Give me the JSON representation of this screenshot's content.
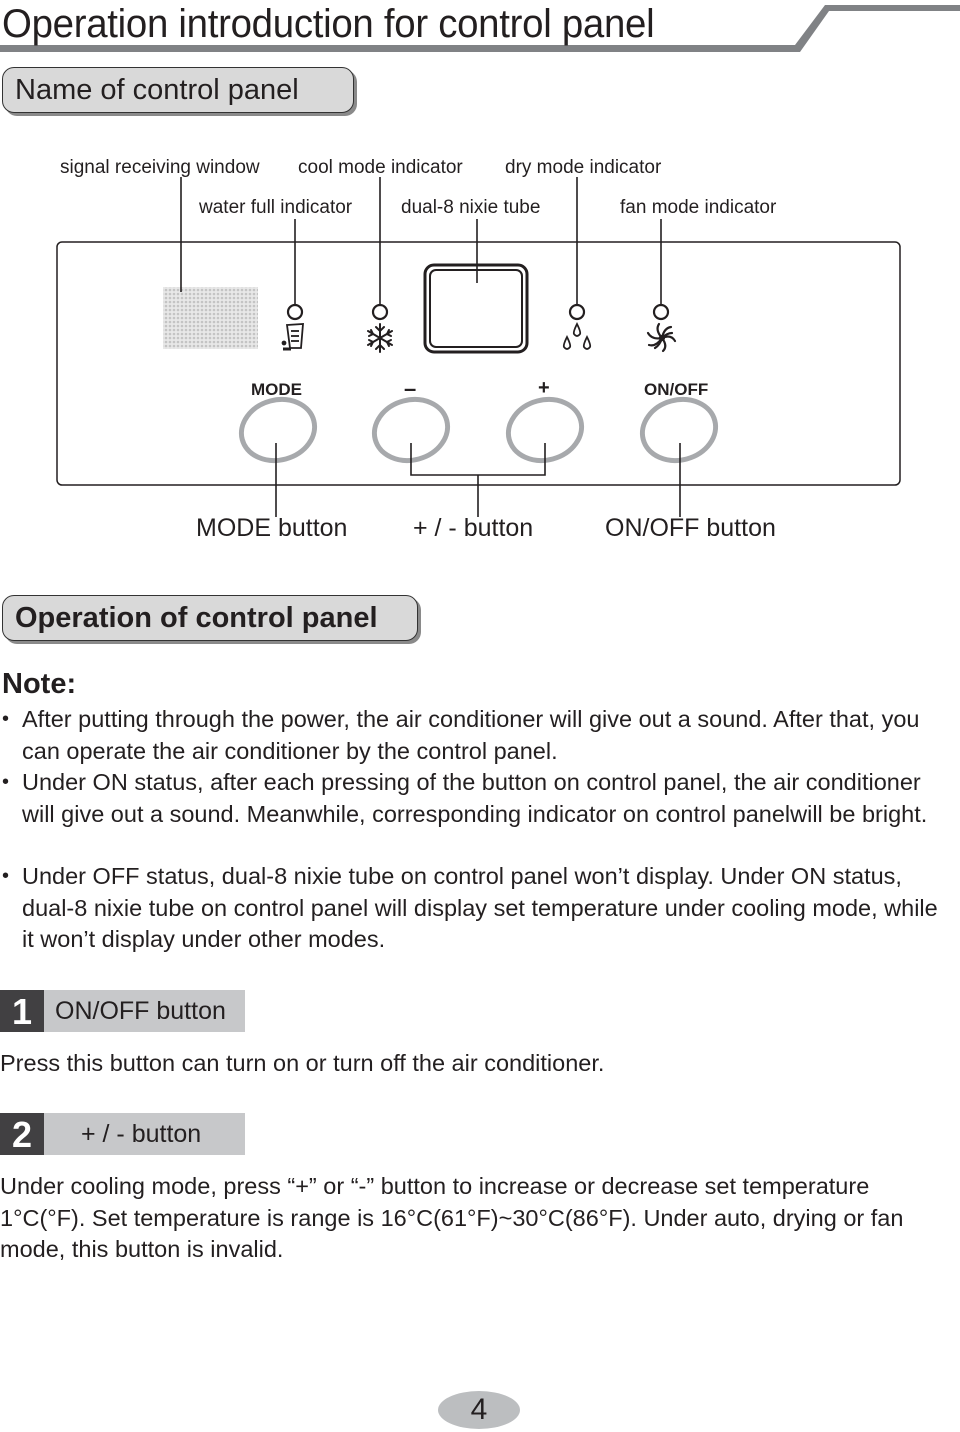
{
  "page": {
    "title": "Operation introduction for control panel",
    "page_number": "4"
  },
  "section_name": {
    "heading": "Name of control panel",
    "labels": {
      "signal_receiving_window": "signal receiving window",
      "cool_mode_indicator": "cool mode indicator",
      "dry_mode_indicator": "dry mode indicator",
      "water_full_indicator": "water full indicator",
      "dual8_nixie_tube": "dual-8 nixie tube",
      "fan_mode_indicator": "fan mode indicator"
    },
    "panel_buttons": {
      "mode": "MODE",
      "minus": "–",
      "plus": "+",
      "onoff": "ON/OFF"
    },
    "button_labels": {
      "mode_button": "MODE button",
      "plus_minus_button": "+ / - button",
      "onoff_button": "ON/OFF button"
    },
    "icons": [
      "signal-window-dots-icon",
      "water-full-icon",
      "snowflake-icon",
      "nixie-display-icon",
      "water-drops-icon",
      "fan-icon"
    ]
  },
  "section_operation": {
    "heading": "Operation of control panel",
    "note_title": "Note:",
    "notes": [
      {
        "bullet": "•",
        "text": "After putting through the power, the air conditioner will give out a sound. After that, you can operate the air conditioner by the control panel."
      },
      {
        "bullet": "•",
        "text": "Under ON status, after each pressing of the button on control panel, the air conditioner will give out a sound. Meanwhile, corresponding indicator on control panelwill be bright."
      },
      {
        "bullet": "•",
        "text": "Under OFF status, dual-8 nixie tube on control panel won’t display. Under ON status, dual-8 nixie tube on control panel will display set temperature under cooling mode, while it won’t display under other modes."
      }
    ],
    "items": [
      {
        "number": "1",
        "label": "ON/OFF button",
        "description": "Press this button can turn on or turn off the air conditioner."
      },
      {
        "number": "2",
        "label": "+ / - button",
        "description": "Under cooling mode, press “+” or “-” button to increase or decrease set temperature 1°C(°F). Set temperature is range is 16°C(61°F)~30°C(86°F). Under auto, drying or fan mode, this button is invalid."
      }
    ]
  }
}
